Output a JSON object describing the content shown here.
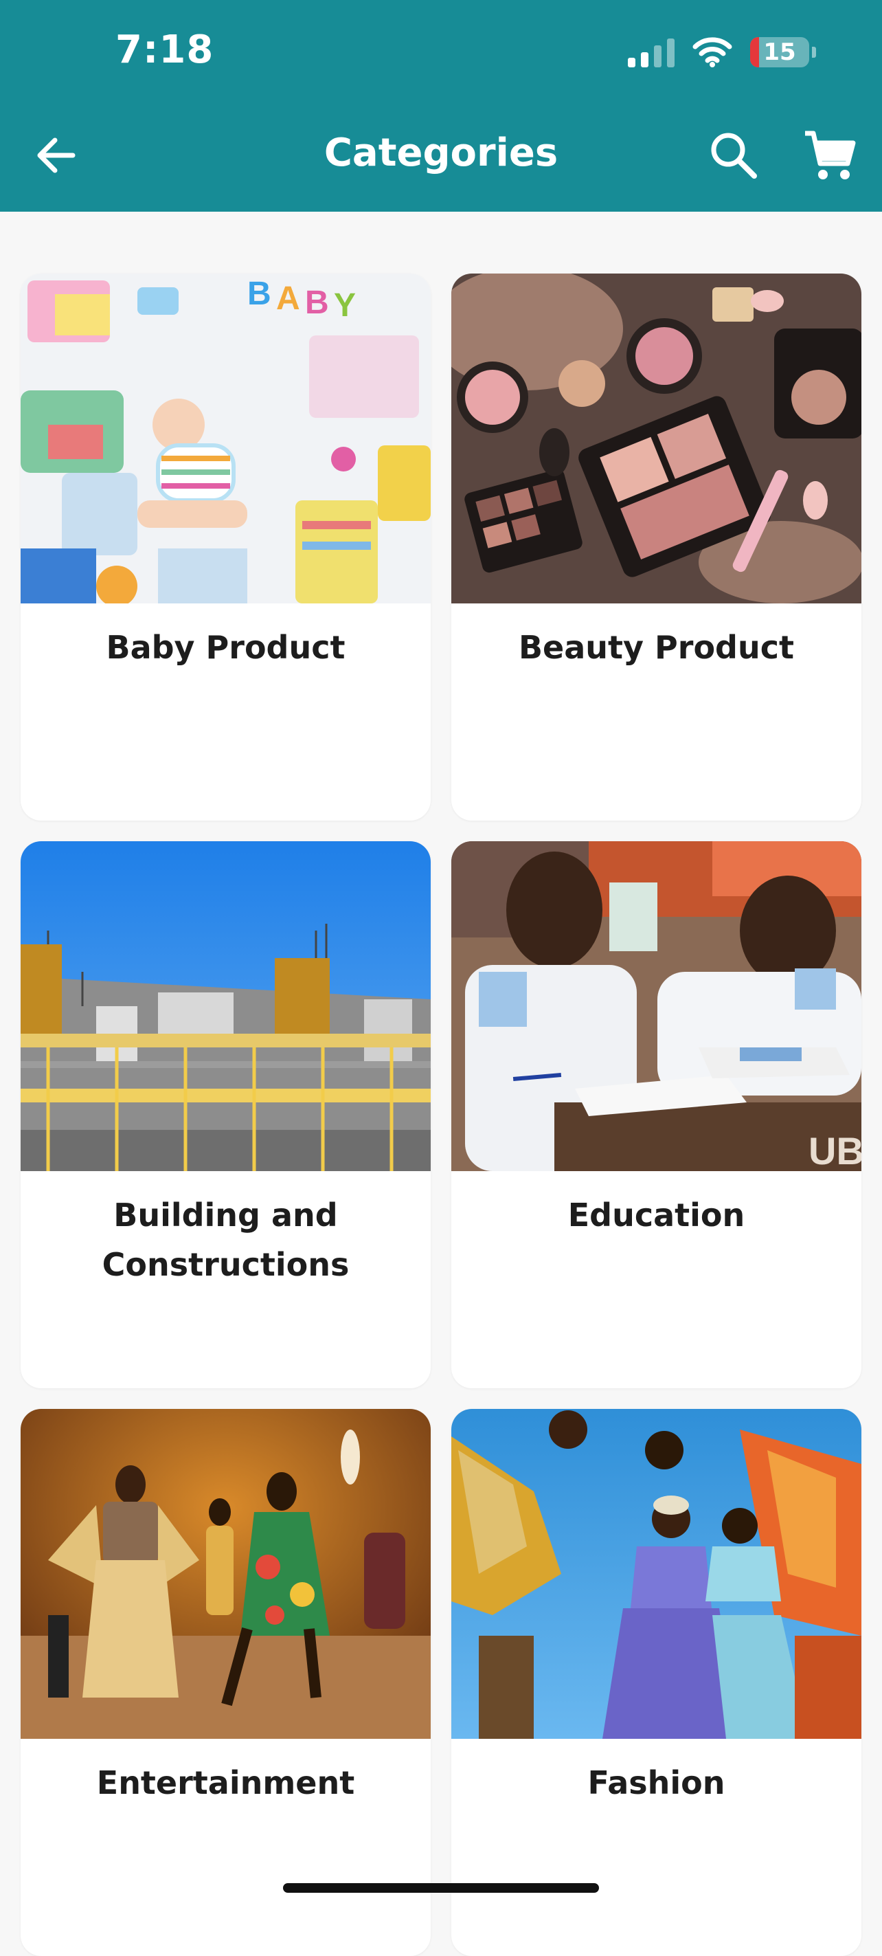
{
  "status_bar": {
    "time": "7:18",
    "battery_level": "15",
    "battery_fraction": 0.15
  },
  "header": {
    "title": "Categories",
    "back_icon": "arrow-left-icon",
    "search_icon": "search-icon",
    "cart_icon": "cart-icon",
    "background": "#178c96"
  },
  "categories": [
    {
      "label": "Baby Product",
      "image": "baby-products-photo"
    },
    {
      "label": "Beauty Product",
      "image": "makeup-cosmetics-photo"
    },
    {
      "label": "Building and Constructions",
      "image": "construction-site-photo"
    },
    {
      "label": "Education",
      "image": "students-writing-photo"
    },
    {
      "label": "Entertainment",
      "image": "dancers-performance-photo"
    },
    {
      "label": "Fashion",
      "image": "fashion-models-photo"
    }
  ]
}
